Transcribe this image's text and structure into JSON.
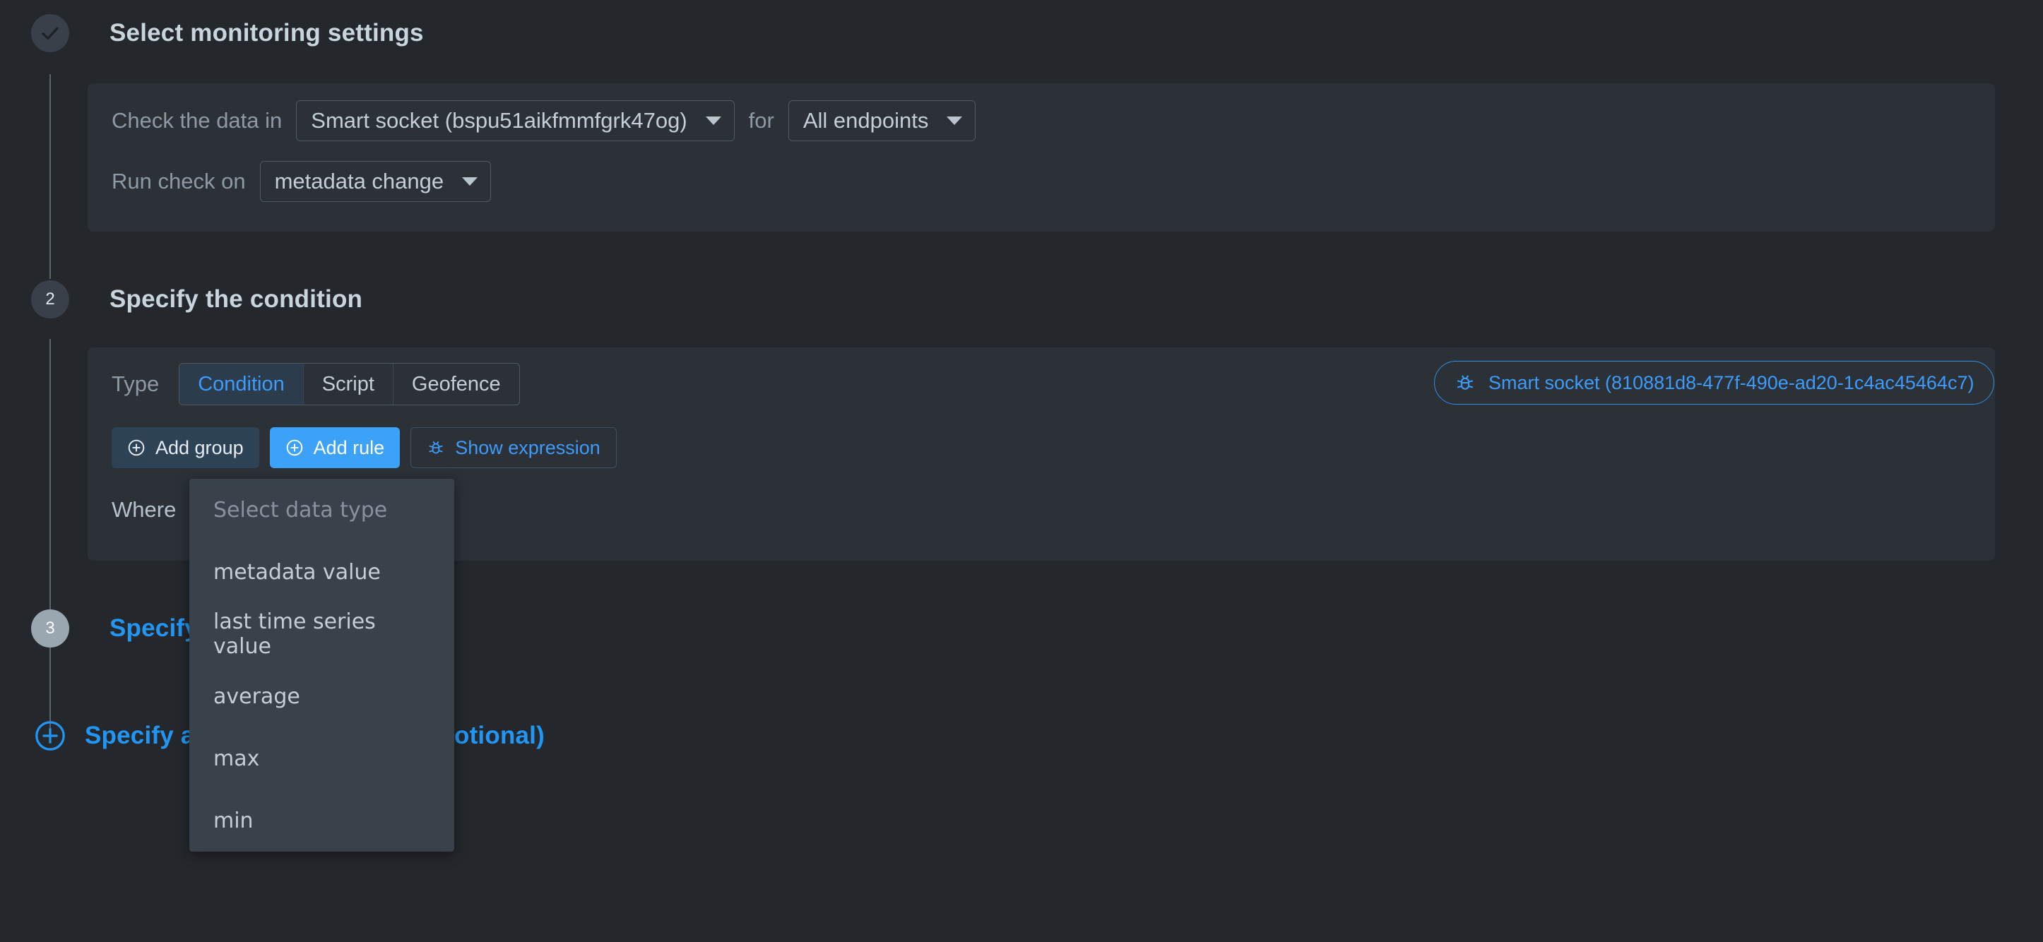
{
  "theme": {
    "background": "#24282c",
    "panel": "#2b3137",
    "accent": "#3d9bfa",
    "primary_button": "#3ba2f7",
    "text": "#c3ced6",
    "muted_text": "#8d99a3",
    "menu_background": "#39424b"
  },
  "steps": [
    {
      "marker": "check-icon",
      "marker_type": "done",
      "title": "Select monitoring settings"
    },
    {
      "marker": "2",
      "marker_type": "number-dark",
      "title": "Specify the condition"
    },
    {
      "marker": "3",
      "marker_type": "number-light",
      "title": "Specify"
    },
    {
      "marker": "plus-icon",
      "marker_type": "plus",
      "title": "Specify a",
      "title_tail": "otional)"
    }
  ],
  "monitoring_settings": {
    "row1": {
      "label_before": "Check the data in",
      "device_select": {
        "value": "Smart socket (bspu51aikfmmfgrk47og)",
        "caret": "chevron-down-icon"
      },
      "label_between": "for",
      "endpoints_select": {
        "value": "All endpoints",
        "caret": "chevron-down-icon"
      }
    },
    "row2": {
      "label": "Run check on",
      "trigger_select": {
        "value": "metadata change",
        "caret": "chevron-down-icon"
      }
    }
  },
  "condition": {
    "type_label": "Type",
    "tabs": [
      {
        "label": "Condition",
        "active": true
      },
      {
        "label": "Script",
        "active": false
      },
      {
        "label": "Geofence",
        "active": false
      }
    ],
    "buttons": [
      {
        "label": "Add group",
        "icon": "plus-circle-icon",
        "style": "secondary"
      },
      {
        "label": "Add rule",
        "icon": "plus-circle-icon",
        "style": "primary"
      },
      {
        "label": "Show expression",
        "icon": "bug-icon",
        "style": "outline"
      }
    ],
    "where_label": "Where",
    "device_badge": {
      "icon": "bug-icon",
      "label": "Smart socket (810881d8-477f-490e-ad20-1c4ac45464c7)"
    }
  },
  "data_type_dropdown": {
    "placeholder": "Select data type",
    "items": [
      "metadata value",
      "last time series value",
      "average",
      "max",
      "min"
    ]
  }
}
